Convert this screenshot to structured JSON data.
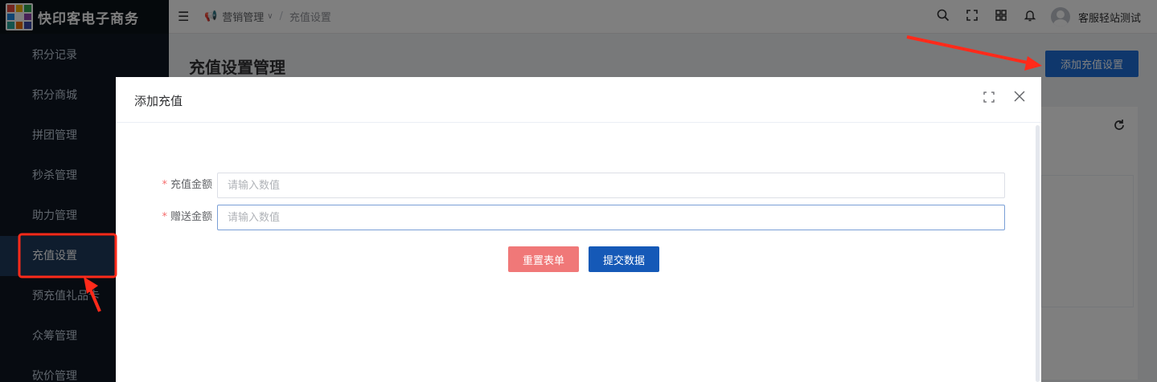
{
  "brand": {
    "title": "快印客电子商务"
  },
  "sidebar": {
    "items": [
      {
        "label": "积分记录"
      },
      {
        "label": "积分商城"
      },
      {
        "label": "拼团管理"
      },
      {
        "label": "秒杀管理"
      },
      {
        "label": "助力管理"
      },
      {
        "label": "充值设置",
        "active": true
      },
      {
        "label": "预充值礼品卡"
      },
      {
        "label": "众筹管理"
      },
      {
        "label": "砍价管理"
      }
    ]
  },
  "header": {
    "breadcrumb": {
      "parent": "营销管理",
      "separator": "/",
      "current": "充值设置"
    },
    "icons": [
      "search-icon",
      "fullscreen-icon",
      "layout-icon",
      "bell-icon"
    ],
    "username": "客服轻站测试"
  },
  "page": {
    "title": "充值设置管理",
    "add_button": "添加充值设置"
  },
  "dialog": {
    "title": "添加充值",
    "fields": [
      {
        "label": "充值金额",
        "required": true,
        "value": "",
        "placeholder": "请输入数值"
      },
      {
        "label": "赠送金额",
        "required": true,
        "value": "",
        "placeholder": "请输入数值"
      }
    ],
    "reset_button": "重置表单",
    "submit_button": "提交数据"
  },
  "colors": {
    "primary": "#1e6fd9",
    "danger": "#f07878",
    "sidebar_bg": "#0f1722",
    "annotation": "#ff2a1a"
  }
}
